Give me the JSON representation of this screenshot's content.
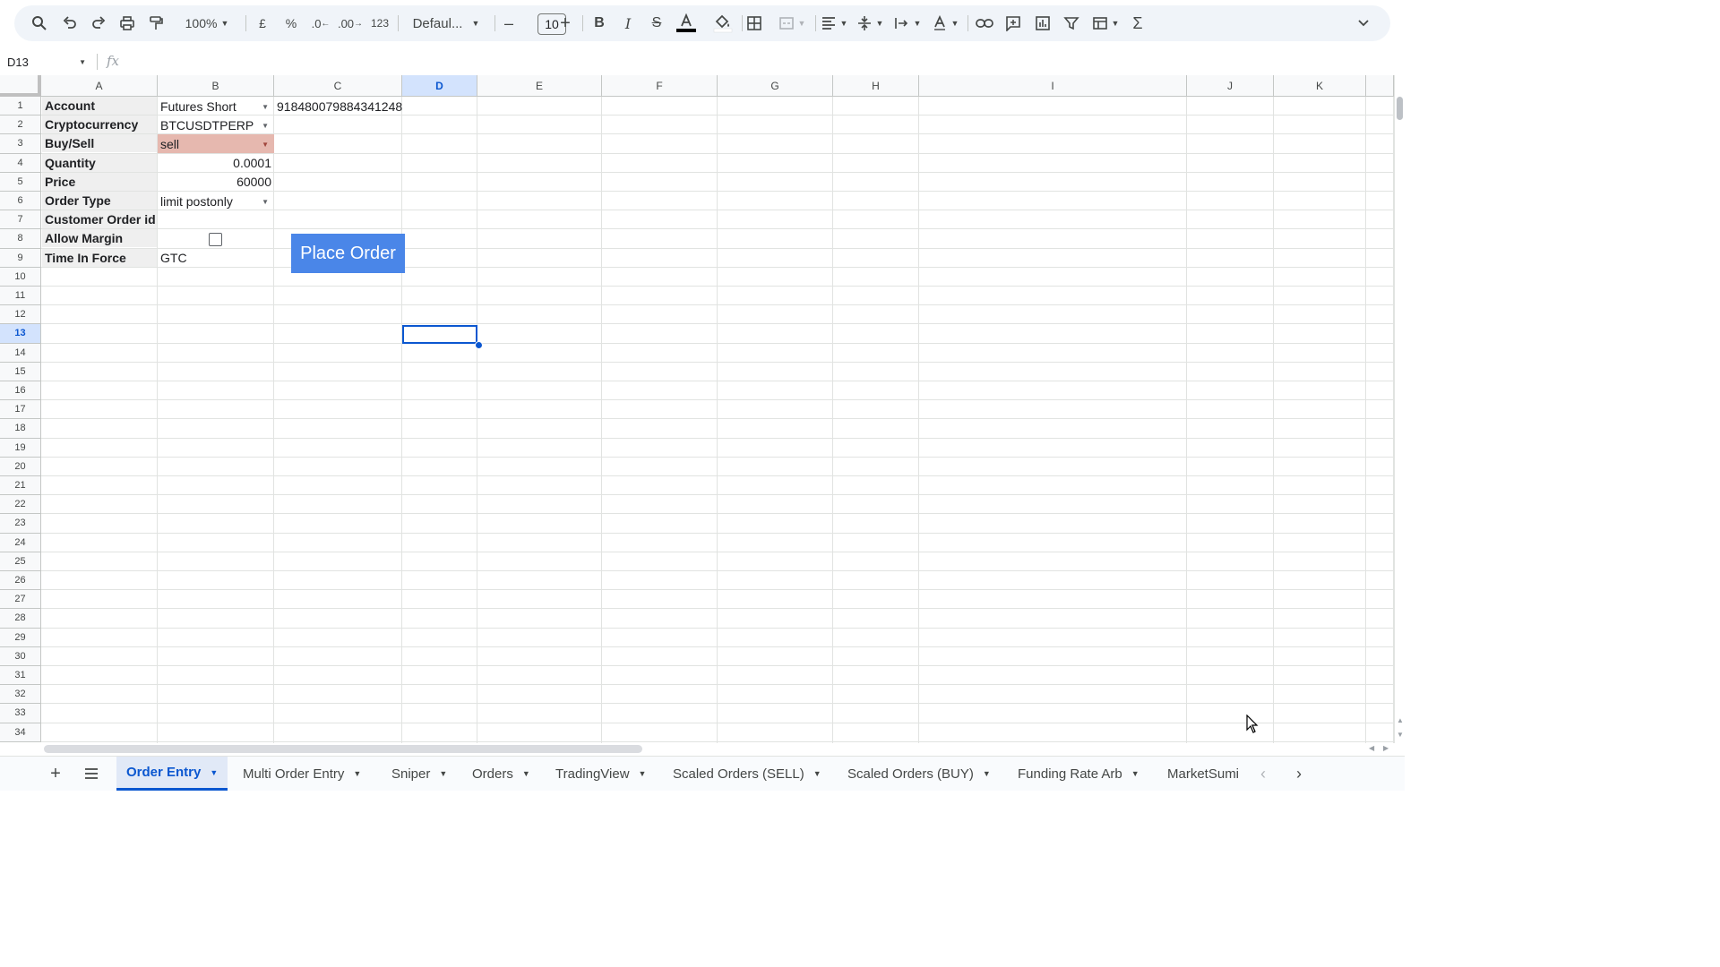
{
  "toolbar": {
    "zoom": "100%",
    "currency_label": "£",
    "percent_label": "%",
    "decimal_decrease_label": ".0",
    "decimal_increase_label": ".00",
    "number_format_label": "123",
    "font_name": "Defaul...",
    "font_size": "10",
    "icons": [
      "search-icon",
      "undo-icon",
      "redo-icon",
      "print-icon",
      "paint-format-icon",
      "bold-icon",
      "italic-icon",
      "strikethrough-icon",
      "text-color-icon",
      "fill-color-icon",
      "borders-icon",
      "merge-icon",
      "align-left-icon",
      "vertical-align-icon",
      "text-wrap-icon",
      "text-rotation-icon",
      "link-icon",
      "comment-icon",
      "chart-icon",
      "filter-icon",
      "table-view-icon",
      "functions-icon",
      "collapse-icon"
    ]
  },
  "formula_bar": {
    "name_box": "D13",
    "fx_label": "fx",
    "formula": ""
  },
  "columns": [
    "A",
    "B",
    "C",
    "D",
    "E",
    "F",
    "G",
    "H",
    "I",
    "J",
    "K"
  ],
  "selected_column": "D",
  "rows": [
    "1",
    "2",
    "3",
    "4",
    "5",
    "6",
    "7",
    "8",
    "9",
    "10",
    "11",
    "12",
    "13",
    "14",
    "15",
    "16",
    "17",
    "18",
    "19",
    "20",
    "21",
    "22",
    "23",
    "24",
    "25",
    "26",
    "27",
    "28",
    "29",
    "30",
    "31",
    "32",
    "33",
    "34"
  ],
  "selected_row": "13",
  "sheet": {
    "labels": [
      "Account",
      "Cryptocurrency",
      "Buy/Sell",
      "Quantity",
      "Price",
      "Order Type",
      "Customer Order id",
      "Allow Margin",
      "Time In Force"
    ],
    "account": "Futures Short",
    "account_id": "918480079884341248",
    "cryptocurrency": "BTCUSDTPERP",
    "buy_sell": "sell",
    "quantity": "0.0001",
    "price": "60000",
    "order_type": "limit postonly",
    "customer_order_id": "",
    "allow_margin": false,
    "time_in_force": "GTC"
  },
  "place_order_button": "Place Order",
  "colors": {
    "accent": "#0b57d0",
    "button": "#4a86e8",
    "sell_fill": "#e6b8af",
    "label_fill": "#efefef"
  },
  "tabs": [
    {
      "label": "Order Entry",
      "active": true
    },
    {
      "label": "Multi Order Entry",
      "active": false
    },
    {
      "label": "Sniper",
      "active": false
    },
    {
      "label": "Orders",
      "active": false
    },
    {
      "label": "TradingView",
      "active": false
    },
    {
      "label": "Scaled Orders (SELL)",
      "active": false
    },
    {
      "label": "Scaled Orders (BUY)",
      "active": false
    },
    {
      "label": "Funding Rate Arb",
      "active": false
    },
    {
      "label": "MarketSumi",
      "active": false
    }
  ]
}
